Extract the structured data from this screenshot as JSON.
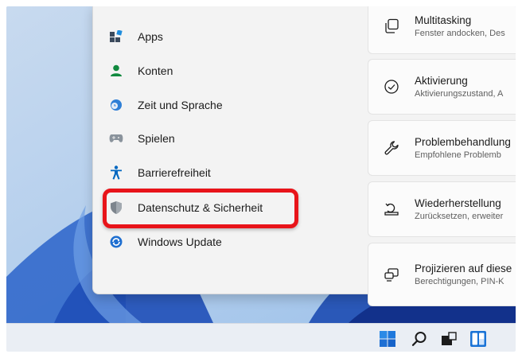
{
  "nav": {
    "items": [
      {
        "label": "Apps",
        "icon": "apps-icon"
      },
      {
        "label": "Konten",
        "icon": "accounts-icon"
      },
      {
        "label": "Zeit und Sprache",
        "icon": "time-language-icon"
      },
      {
        "label": "Spielen",
        "icon": "gaming-icon"
      },
      {
        "label": "Barrierefreiheit",
        "icon": "accessibility-icon"
      },
      {
        "label": "Datenschutz & Sicherheit",
        "icon": "shield-icon"
      },
      {
        "label": "Windows Update",
        "icon": "windows-update-icon"
      }
    ],
    "highlighted": "Datenschutz & Sicherheit"
  },
  "cards": [
    {
      "title": "Multitasking",
      "subtitle": "Fenster andocken, Des",
      "icon": "multitasking-icon"
    },
    {
      "title": "Aktivierung",
      "subtitle": "Aktivierungszustand, A",
      "icon": "activation-check-icon"
    },
    {
      "title": "Problembehandlung",
      "subtitle": "Empfohlene Problemb",
      "icon": "troubleshoot-wrench-icon"
    },
    {
      "title": "Wiederherstellung",
      "subtitle": "Zurücksetzen, erweiter",
      "icon": "recovery-icon"
    },
    {
      "title": "Projizieren auf diese",
      "subtitle": "Berechtigungen, PIN-K",
      "icon": "projection-icon"
    }
  ],
  "taskbar": {
    "items": [
      "start-icon",
      "search-icon",
      "task-view-icon",
      "widgets-icon"
    ]
  },
  "colors": {
    "highlight_border": "#e8141a",
    "accent_blue": "#0067c0",
    "accounts_green": "#10893e"
  }
}
